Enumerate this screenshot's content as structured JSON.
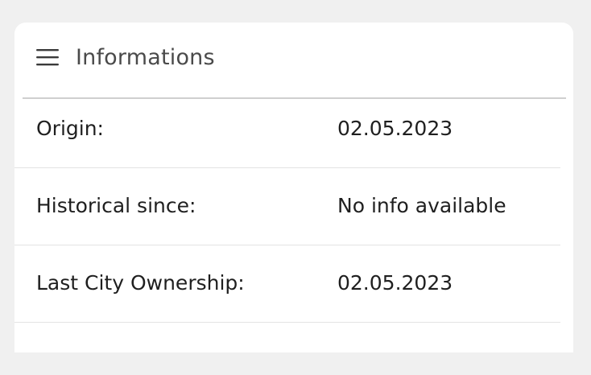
{
  "card": {
    "title": "Informations",
    "menu_icon": "hamburger-menu-icon"
  },
  "rows": [
    {
      "label": "Origin:",
      "value": "02.05.2023"
    },
    {
      "label": "Historical since:",
      "value": "No info available"
    },
    {
      "label": "Last City Ownership:",
      "value": "02.05.2023"
    }
  ],
  "colors": {
    "page_background": "#f0f0f0",
    "card_background": "#ffffff",
    "title_text": "#4a4a4a",
    "body_text": "#1f1f1f",
    "divider": "#cfcfcf",
    "row_separator": "#e3e3e3"
  }
}
